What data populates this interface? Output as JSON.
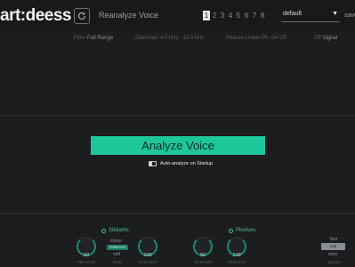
{
  "header": {
    "logo_prefix": "art:",
    "logo_main": "deess",
    "reanalyze_label": "Reanalyze Voice",
    "presets": [
      "1",
      "2",
      "3",
      "4",
      "5",
      "6",
      "7",
      "8"
    ],
    "active_preset": "1",
    "preset_select": "default",
    "save_label": "save"
  },
  "options": {
    "range_prefix": "Filter",
    "range_value": "Full Range",
    "sidechain": "Sidechain  4.0 kHz - 10.0 kHz",
    "phases": "Phases  Linear Ph. On Off",
    "signal_prefix": "Off",
    "signal_value": "Signal"
  },
  "main": {
    "analyze_button": "Analyze Voice",
    "auto_analyze_label": "Auto-analyze on Startup"
  },
  "sibilants": {
    "title": "Sibilants",
    "knob1_value": "50",
    "knob1_caption": "Threshold",
    "mode_top": "sharp",
    "mode_active": "balanced",
    "mode_bottom": "soft",
    "mode_caption": "Mode",
    "knob2_value": "100",
    "knob2_caption": "Reduction"
  },
  "plosives": {
    "title": "Plosives",
    "knob1_value": "50",
    "knob1_caption": "Threshold",
    "knob2_value": "100",
    "knob2_caption": "Reduction"
  },
  "speed": {
    "top": "fast",
    "active": "mid",
    "bottom": "slow",
    "caption": "Speed"
  },
  "colors": {
    "accent": "#1ec79a",
    "background": "#1c1d1f"
  }
}
